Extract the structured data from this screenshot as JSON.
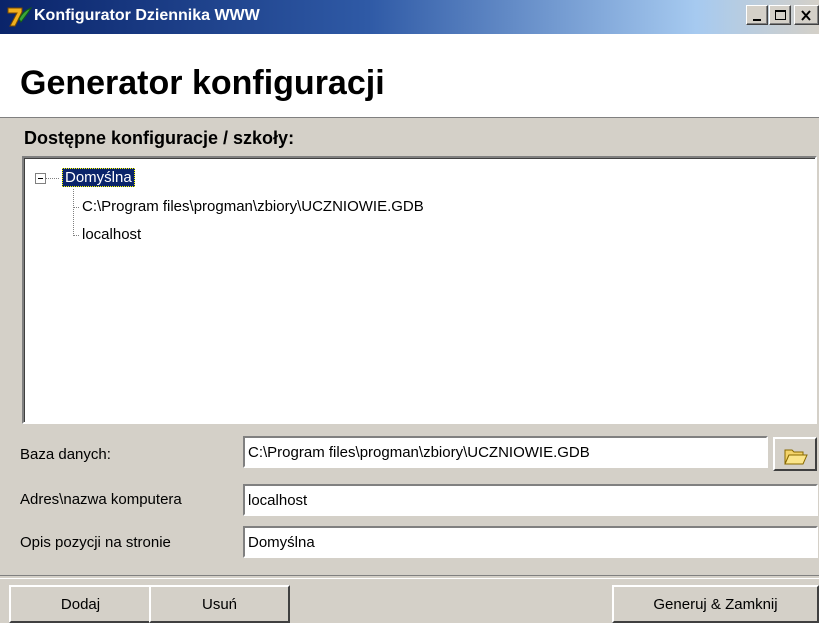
{
  "window": {
    "title": "Konfigurator Dziennika WWW",
    "icon": "app-7-logo-icon",
    "controls": [
      "minimize-icon",
      "maximize-icon",
      "close-icon"
    ]
  },
  "header": {
    "title": "Generator konfiguracji"
  },
  "tree": {
    "label": "Dostępne konfiguracje / szkoły:",
    "root": {
      "label": "Domyślna",
      "expanded": true,
      "selected": true,
      "children": [
        {
          "label": "C:\\Program files\\progman\\zbiory\\UCZNIOWIE.GDB"
        },
        {
          "label": "localhost"
        }
      ]
    }
  },
  "form": {
    "database": {
      "label": "Baza danych:",
      "value": "C:\\Program files\\progman\\zbiory\\UCZNIOWIE.GDB",
      "browse_icon": "folder-open-icon"
    },
    "host": {
      "label": "Adres\\nazwa komputera",
      "value": "localhost"
    },
    "description": {
      "label": "Opis pozycji na stronie",
      "value": "Domyślna"
    }
  },
  "buttons": {
    "add": "Dodaj",
    "remove": "Usuń",
    "generate_close": "Generuj & Zamknij"
  },
  "colors": {
    "titlebar_start": "#0a246a",
    "titlebar_end": "#a6caf0",
    "face": "#d4d0c8",
    "selection": "#0a246a"
  }
}
